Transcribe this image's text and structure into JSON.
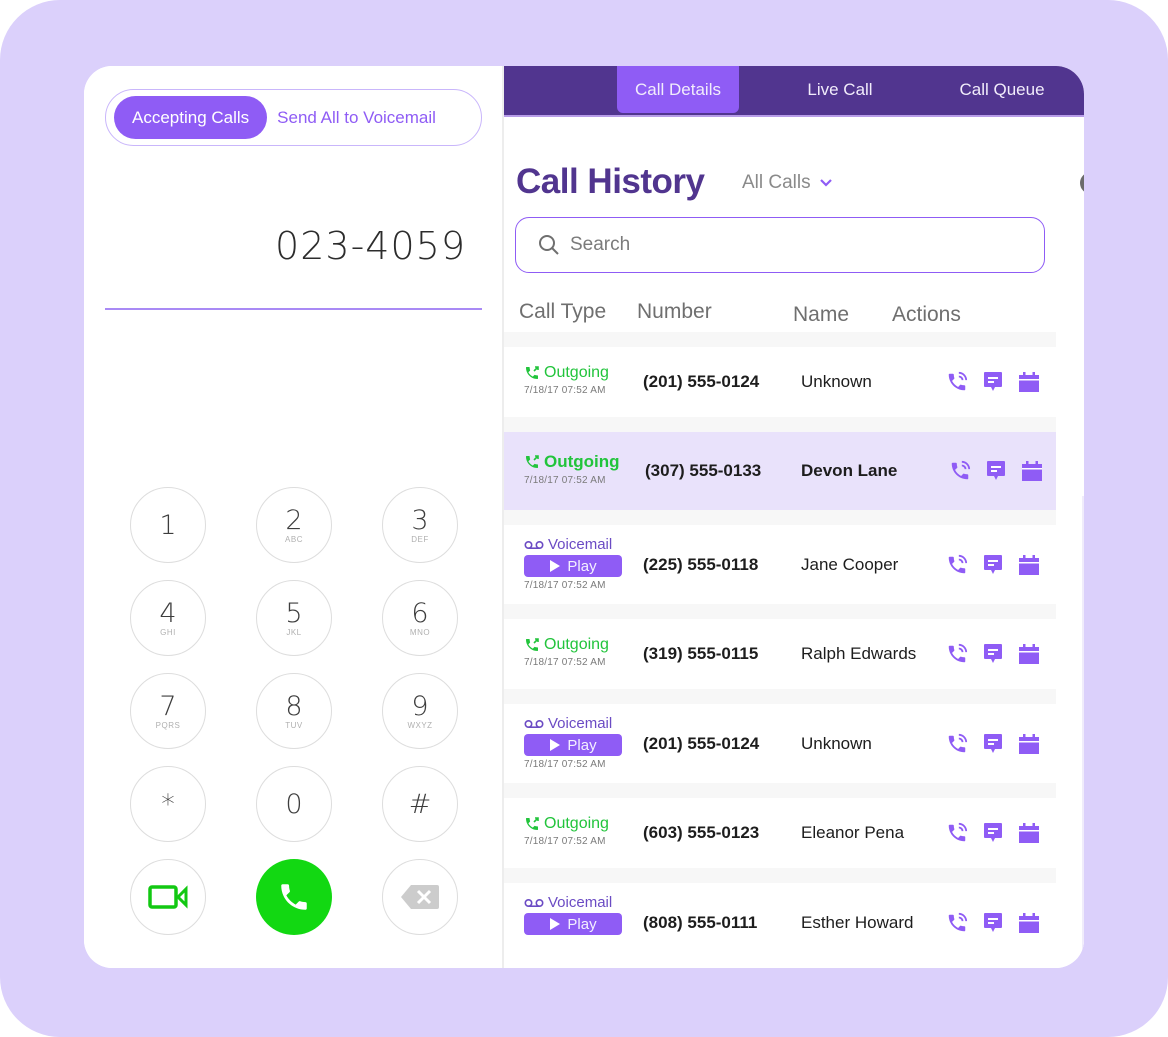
{
  "colors": {
    "background_frame": "#dbd0fb",
    "accent": "#8f5cf5",
    "nav_bg": "#51358f",
    "title": "#51358f",
    "outgoing_green": "#22c43c",
    "call_button_green": "#12d812",
    "voicemail_purple": "#6b4bc4",
    "highlight_row": "#e9e2fb"
  },
  "dialer": {
    "status_toggle": {
      "active": "Accepting Calls",
      "inactive": "Send All to Voicemail"
    },
    "number": "023-4059",
    "keys": [
      {
        "digit": "1",
        "letters": ""
      },
      {
        "digit": "2",
        "letters": "ABC"
      },
      {
        "digit": "3",
        "letters": "DEF"
      },
      {
        "digit": "4",
        "letters": "GHI"
      },
      {
        "digit": "5",
        "letters": "JKL"
      },
      {
        "digit": "6",
        "letters": "MNO"
      },
      {
        "digit": "7",
        "letters": "PQRS"
      },
      {
        "digit": "8",
        "letters": "TUV"
      },
      {
        "digit": "9",
        "letters": "WXYZ"
      },
      {
        "digit": "*",
        "letters": ""
      },
      {
        "digit": "0",
        "letters": ""
      },
      {
        "digit": "#",
        "letters": ""
      }
    ],
    "bottom_buttons": {
      "video": "video-camera-icon",
      "call": "phone-icon",
      "backspace": "backspace-icon"
    }
  },
  "nav": {
    "tabs": [
      {
        "label": "Call Details",
        "active": true
      },
      {
        "label": "Live Call",
        "active": false
      },
      {
        "label": "Call Queue",
        "active": false
      }
    ]
  },
  "call_history": {
    "title": "Call History",
    "filter": "All Calls",
    "search_placeholder": "Search",
    "columns": [
      "Call Type",
      "Number",
      "Name",
      "Actions"
    ],
    "play_label": "Play",
    "rows": [
      {
        "type": "Outgoing",
        "time": "7/18/17 07:52 AM",
        "number": "(201) 555-0124",
        "name": "Unknown",
        "highlight": false
      },
      {
        "type": "Outgoing",
        "time": "7/18/17 07:52 AM",
        "number": "(307) 555-0133",
        "name": "Devon Lane",
        "highlight": true
      },
      {
        "type": "Voicemail",
        "time": "7/18/17 07:52 AM",
        "number": "(225) 555-0118",
        "name": "Jane Cooper",
        "highlight": false
      },
      {
        "type": "Outgoing",
        "time": "7/18/17 07:52 AM",
        "number": "(319) 555-0115",
        "name": "Ralph Edwards",
        "highlight": false
      },
      {
        "type": "Voicemail",
        "time": "7/18/17 07:52 AM",
        "number": "(201) 555-0124",
        "name": "Unknown",
        "highlight": false
      },
      {
        "type": "Outgoing",
        "time": "7/18/17 07:52 AM",
        "number": "(603) 555-0123",
        "name": "Eleanor Pena",
        "highlight": false
      },
      {
        "type": "Voicemail",
        "time": "",
        "number": "(808) 555-0111",
        "name": "Esther Howard",
        "highlight": false
      }
    ],
    "row_actions": [
      "call-back-icon",
      "message-icon",
      "calendar-icon"
    ]
  }
}
